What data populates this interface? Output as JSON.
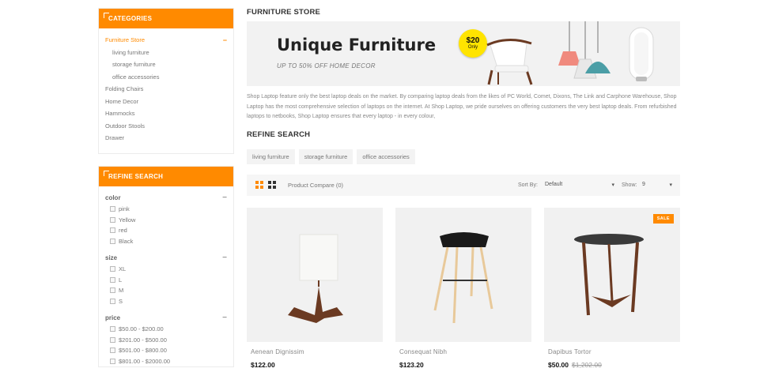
{
  "sidebar": {
    "categories_title": "CATEGORIES",
    "categories": [
      {
        "label": "Furniture Store",
        "active": true
      },
      {
        "label": "living furniture",
        "sub": true
      },
      {
        "label": "storage furniture",
        "sub": true
      },
      {
        "label": "office accessories",
        "sub": true
      },
      {
        "label": "Folding Chairs"
      },
      {
        "label": "Home Decor"
      },
      {
        "label": "Hammocks"
      },
      {
        "label": "Outdoor Stools"
      },
      {
        "label": "Drawer"
      }
    ],
    "refine_title": "REFINE SEARCH",
    "filters": {
      "color": {
        "title": "color",
        "options": [
          "pink",
          "Yellow",
          "red",
          "Black"
        ]
      },
      "size": {
        "title": "size",
        "options": [
          "XL",
          "L",
          "M",
          "S"
        ]
      },
      "price": {
        "title": "price",
        "options": [
          "$50.00 - $200.00",
          "$201.00 - $500.00",
          "$501.00 - $800.00",
          "$801.00 - $2000.00"
        ]
      }
    }
  },
  "main": {
    "store_title": "FURNITURE STORE",
    "banner": {
      "heading": "Unique Furniture",
      "subheading": "UP TO 50% OFF HOME DECOR",
      "badge_price": "$20",
      "badge_label": "Only"
    },
    "description": "Shop Laptop feature only the best laptop deals on the market. By comparing laptop deals from the likes of PC World, Comet, Dixons, The Link and Carphone Warehouse, Shop Laptop has the most comprehensive selection of laptops on the internet. At Shop Laptop, we pride ourselves on offering customers the very best laptop deals. From refurbished laptops to netbooks, Shop Laptop ensures that every laptop - in every colour,",
    "refine_title": "REFINE SEARCH",
    "tags": [
      "living furniture",
      "storage furniture",
      "office accessories"
    ],
    "toolbar": {
      "compare": "Product Compare (0)",
      "sort_label": "Sort By:",
      "sort_value": "Default",
      "show_label": "Show:",
      "show_value": "9"
    },
    "products": [
      {
        "name": "Aenean Dignissim",
        "price": "$122.00",
        "old_price": ""
      },
      {
        "name": "Consequat Nibh",
        "price": "$123.20",
        "old_price": ""
      },
      {
        "name": "Dapibus Tortor",
        "price": "$50.00",
        "old_price": "$1,202.00",
        "sale": "SALE"
      }
    ]
  },
  "colors": {
    "accent": "#ff8a00"
  }
}
